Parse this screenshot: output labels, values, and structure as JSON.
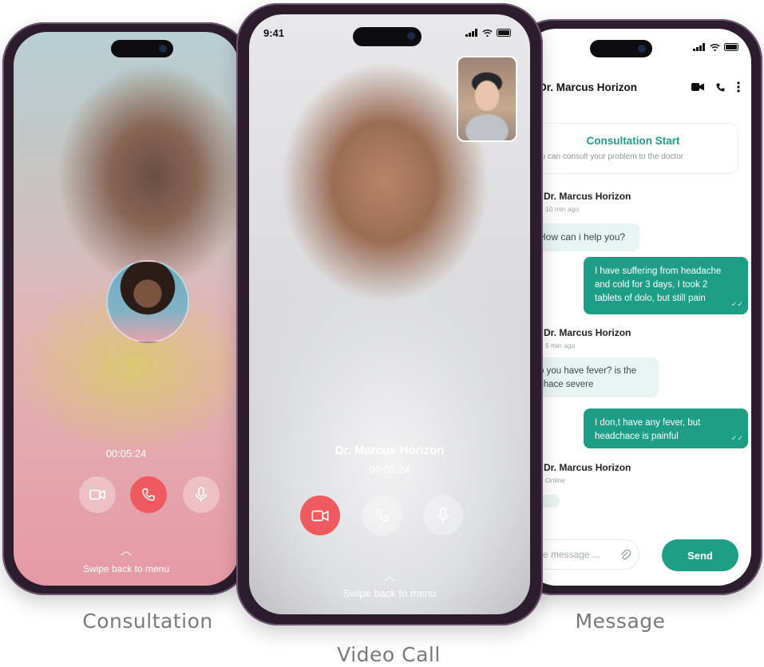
{
  "consultation": {
    "timer": "00:05:24",
    "swipe_hint": "Swipe back to menu"
  },
  "video_call": {
    "status_time": "9:41",
    "doctor_name": "Dr. Marcus Horizon",
    "timer": "00:05:24",
    "swipe_hint": "Swipe back to menu"
  },
  "message": {
    "header_title": "Dr. Marcus Horizon",
    "consult_title": "Consultation Start",
    "consult_subtitle": "ou can consult your problem to the doctor",
    "messages": [
      {
        "sender": "Dr. Marcus Horizon",
        "time": "10 min ago",
        "text": "How can i help you?"
      },
      {
        "text": "I have suffering from headache and cold for 3 days, I took 2 tablets of dolo, but still pain"
      },
      {
        "sender": "Dr. Marcus Horizon",
        "time": "5 min ago",
        "text": "o you have fever? is the chace severe"
      },
      {
        "text": "I don,t have any fever, but headchace is painful"
      },
      {
        "sender": "Dr. Marcus Horizon",
        "time": "Online"
      }
    ],
    "input_placeholder": "e message ...",
    "send_label": "Send"
  },
  "captions": {
    "left": "Consultation",
    "center": "Video Call",
    "right": "Message"
  },
  "colors": {
    "accent": "#1e9d87",
    "end_call": "#ef5a5e",
    "frame": "#2b1d2b"
  }
}
